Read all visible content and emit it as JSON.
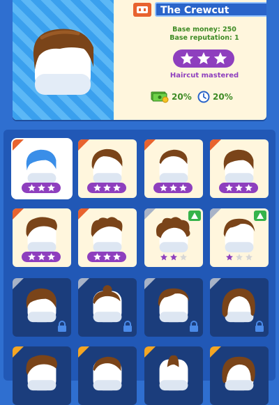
{
  "selected": {
    "title": "The Crewcut",
    "base_money": "Base money: 250",
    "base_reputation": "Base reputation: 1",
    "stars": 3,
    "status": "Haircut mastered",
    "bonus_money": "20%",
    "bonus_time": "20%",
    "icons": [
      "scissors-tag-icon",
      "money-icon",
      "clock-icon"
    ]
  },
  "colors": {
    "background": "#2f6fd0",
    "panel": "#fff6dd",
    "purple": "#8e3fbe",
    "green": "#3e8b25",
    "orange": "#e8632f",
    "hair": "#7a4419",
    "selected_hair": "#3a8ee8"
  },
  "haircuts": [
    {
      "state": "selected",
      "stars": 3,
      "hair": "crew"
    },
    {
      "state": "unlocked",
      "stars": 3,
      "hair": "side"
    },
    {
      "state": "unlocked",
      "stars": 3,
      "hair": "buzz"
    },
    {
      "state": "unlocked",
      "stars": 3,
      "hair": "crew"
    },
    {
      "state": "unlocked",
      "stars": 3,
      "hair": "quiff"
    },
    {
      "state": "unlocked",
      "stars": 3,
      "hair": "messy"
    },
    {
      "state": "upgradable",
      "stars": 2,
      "hair": "curly"
    },
    {
      "state": "upgradable",
      "stars": 1,
      "hair": "swept"
    },
    {
      "state": "locked",
      "stars": 0,
      "hair": "crew"
    },
    {
      "state": "locked",
      "stars": 0,
      "hair": "bun"
    },
    {
      "state": "locked",
      "stars": 0,
      "hair": "swept"
    },
    {
      "state": "locked",
      "stars": 0,
      "hair": "long"
    },
    {
      "state": "locked",
      "stars": 0,
      "hair": "quiff"
    },
    {
      "state": "locked",
      "stars": 0,
      "hair": "buzz"
    },
    {
      "state": "locked",
      "stars": 0,
      "hair": "mohawk"
    },
    {
      "state": "locked",
      "stars": 0,
      "hair": "dreads"
    }
  ]
}
